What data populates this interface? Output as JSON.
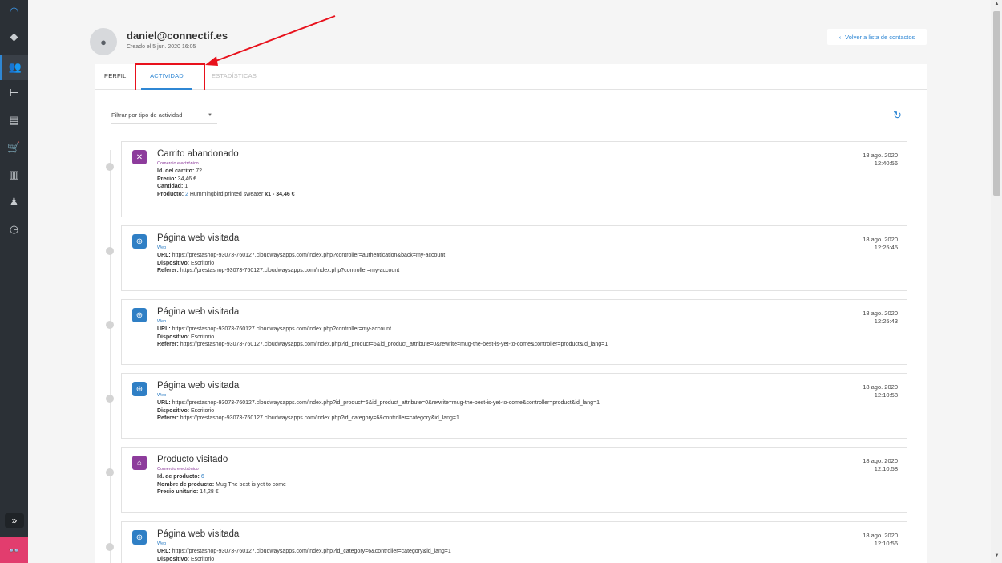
{
  "header": {
    "email": "daniel@connectif.es",
    "created": "Creado el 5 jun. 2020 16:05",
    "back_label": "Volver a lista de contactos"
  },
  "tabs": {
    "perfil": "PERFIL",
    "actividad": "ACTIVIDAD",
    "estadisticas": "ESTADÍSTICAS"
  },
  "filter": {
    "label": "Filtrar por tipo de actividad"
  },
  "entries": [
    {
      "title": "Carrito abandonado",
      "category": "Comercio electrónico",
      "date": "18 ago. 2020",
      "time": "12:40:56",
      "icon": "abandoned-cart-icon",
      "lines": [
        {
          "label": "Id. del carrito:",
          "value": " 72"
        },
        {
          "label": "Precio:",
          "value": " 34,46 €"
        },
        {
          "label": "Cantidad:",
          "value": " 1"
        },
        {
          "label": "Producto:",
          "link": " 2",
          "value": " Hummingbird printed sweater ",
          "bold_tail": "x1 - 34,46 €"
        }
      ]
    },
    {
      "title": "Página web visitada",
      "category": "Web",
      "date": "18 ago. 2020",
      "time": "12:25:45",
      "icon": "globe-icon",
      "lines": [
        {
          "label": "URL:",
          "value": " https://prestashop-93073-760127.cloudwaysapps.com/index.php?controller=authentication&back=my-account"
        },
        {
          "label": "Dispositivo:",
          "value": " Escritorio"
        },
        {
          "label": "Referer:",
          "value": " https://prestashop-93073-760127.cloudwaysapps.com/index.php?controller=my-account"
        }
      ]
    },
    {
      "title": "Página web visitada",
      "category": "Web",
      "date": "18 ago. 2020",
      "time": "12:25:43",
      "icon": "globe-icon",
      "lines": [
        {
          "label": "URL:",
          "value": " https://prestashop-93073-760127.cloudwaysapps.com/index.php?controller=my-account"
        },
        {
          "label": "Dispositivo:",
          "value": " Escritorio"
        },
        {
          "label": "Referer:",
          "value": " https://prestashop-93073-760127.cloudwaysapps.com/index.php?id_product=6&id_product_attribute=0&rewrite=mug-the-best-is-yet-to-come&controller=product&id_lang=1"
        }
      ]
    },
    {
      "title": "Página web visitada",
      "category": "Web",
      "date": "18 ago. 2020",
      "time": "12:10:58",
      "icon": "globe-icon",
      "lines": [
        {
          "label": "URL:",
          "value": " https://prestashop-93073-760127.cloudwaysapps.com/index.php?id_product=6&id_product_attribute=0&rewrite=mug-the-best-is-yet-to-come&controller=product&id_lang=1"
        },
        {
          "label": "Dispositivo:",
          "value": " Escritorio"
        },
        {
          "label": "Referer:",
          "value": " https://prestashop-93073-760127.cloudwaysapps.com/index.php?id_category=6&controller=category&id_lang=1"
        }
      ]
    },
    {
      "title": "Producto visitado",
      "category": "Comercio electrónico",
      "date": "18 ago. 2020",
      "time": "12:10:58",
      "icon": "shopping-basket-icon",
      "lines": [
        {
          "label": "Id. de producto:",
          "link": " 6"
        },
        {
          "label": "Nombre de producto:",
          "value": " Mug The best is yet to come"
        },
        {
          "label": "Precio unitario:",
          "value": " 14,28 €"
        }
      ]
    },
    {
      "title": "Página web visitada",
      "category": "Web",
      "date": "18 ago. 2020",
      "time": "12:10:56",
      "icon": "globe-icon",
      "lines": [
        {
          "label": "URL:",
          "value": " https://prestashop-93073-760127.cloudwaysapps.com/index.php?id_category=6&controller=category&id_lang=1"
        },
        {
          "label": "Dispositivo:",
          "value": " Escritorio"
        }
      ]
    }
  ]
}
